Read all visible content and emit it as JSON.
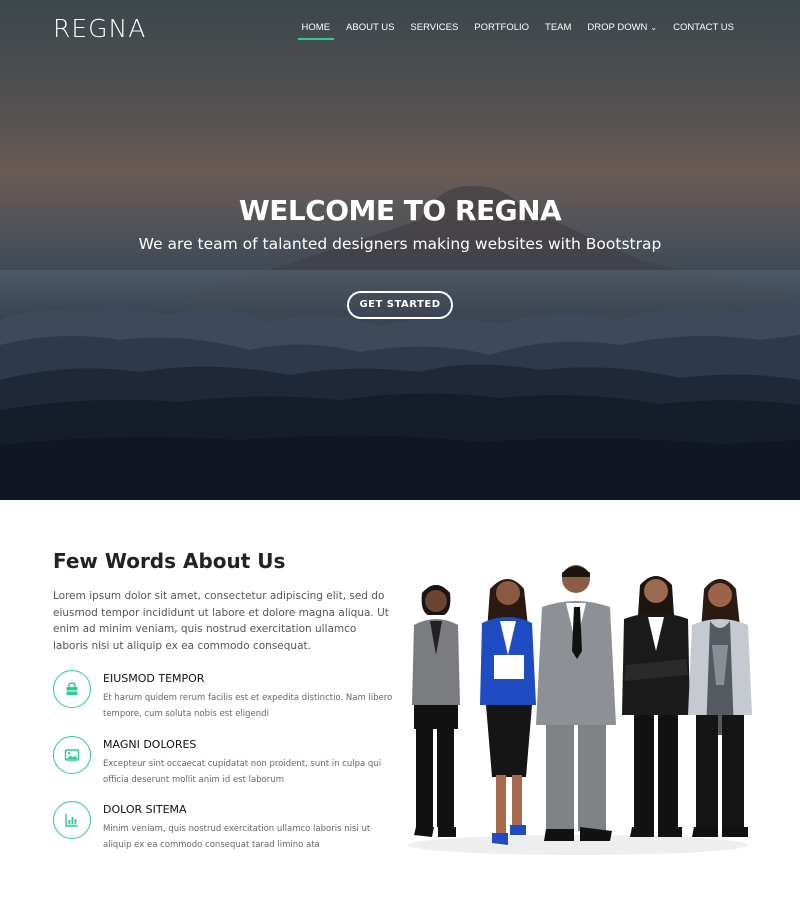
{
  "header": {
    "logo": "REGNA",
    "nav": [
      {
        "label": "HOME",
        "active": true
      },
      {
        "label": "ABOUT US"
      },
      {
        "label": "SERVICES"
      },
      {
        "label": "PORTFOLIO"
      },
      {
        "label": "TEAM"
      },
      {
        "label": "DROP DOWN",
        "has_dropdown": true
      },
      {
        "label": "CONTACT US"
      }
    ]
  },
  "hero": {
    "title": "WELCOME TO REGNA",
    "subtitle": "We are team of talanted designers making websites with Bootstrap",
    "cta_label": "GET STARTED"
  },
  "about": {
    "title": "Few Words About Us",
    "text": "Lorem ipsum dolor sit amet, consectetur adipiscing elit, sed do eiusmod tempor incididunt ut labore et dolore magna aliqua. Ut enim ad minim veniam, quis nostrud exercitation ullamco laboris nisi ut aliquip ex ea commodo consequat.",
    "features": [
      {
        "icon": "shopping-bag-icon",
        "title": "Eiusmod Tempor",
        "text": "Et harum quidem rerum facilis est et expedita distinctio. Nam libero tempore, cum soluta nobis est eligendi"
      },
      {
        "icon": "image-icon",
        "title": "Magni Dolores",
        "text": "Excepteur sint occaecat cupidatat non proident, sunt in culpa qui officia deserunt mollit anim id est laborum"
      },
      {
        "icon": "bar-chart-icon",
        "title": "Dolor Sitema",
        "text": "Minim veniam, quis nostrud exercitation ullamco laboris nisi ut aliquip ex ea commodo consequat tarad limino ata"
      }
    ]
  },
  "colors": {
    "accent": "#2dc997",
    "heading": "#222222",
    "body_text": "#555555"
  }
}
